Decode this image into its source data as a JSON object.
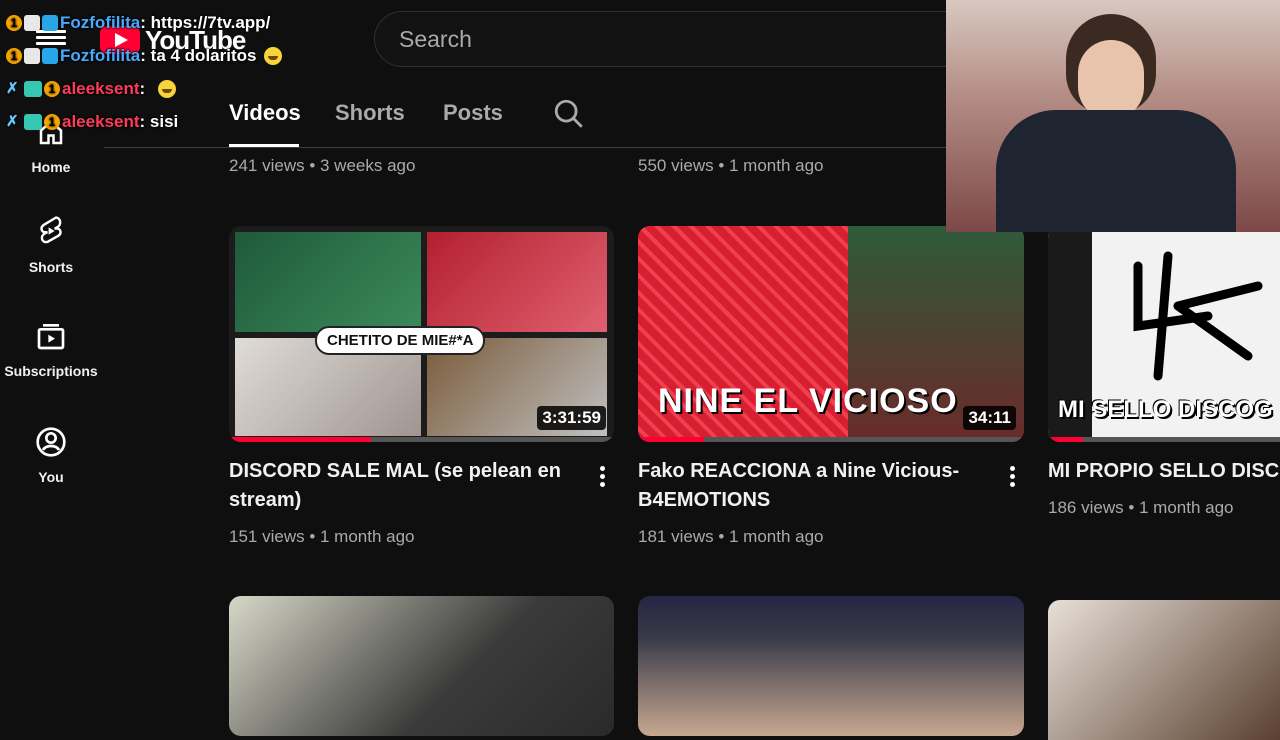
{
  "header": {
    "logo_text": "YouTube",
    "search_placeholder": "Search"
  },
  "sidebar": {
    "items": [
      {
        "label": "Home",
        "icon": "home-icon"
      },
      {
        "label": "Shorts",
        "icon": "shorts-icon"
      },
      {
        "label": "Subscriptions",
        "icon": "subscriptions-icon"
      },
      {
        "label": "You",
        "icon": "you-icon"
      }
    ]
  },
  "tabs": [
    {
      "label": "Videos",
      "active": true
    },
    {
      "label": "Shorts",
      "active": false
    },
    {
      "label": "Posts",
      "active": false
    }
  ],
  "top_row_meta": [
    "241 views • 3 weeks ago",
    "550 views • 1 month ago"
  ],
  "videos": [
    {
      "title": "DISCORD SALE MAL (se pelean en stream)",
      "meta": "151 views • 1 month ago",
      "duration": "3:31:59",
      "thumb_text": "CHETITO DE MIE#*A",
      "watched": 0.37
    },
    {
      "title": "Fako REACCIONA a Nine Vicious-B4EMOTIONS",
      "meta": "181 views • 1 month ago",
      "duration": "34:11",
      "thumb_text": "NINE EL VICIOSO",
      "watched": 0.17
    },
    {
      "title": "MI PROPIO SELLO DISCOG",
      "meta": "186 views • 1 month ago",
      "duration": "",
      "thumb_text": "MI SELLO DISCOG",
      "watched": 0.15
    }
  ],
  "chat": [
    {
      "user": "Fozfofilita",
      "message": "https://7tv.app/",
      "user_color": "#4aa8ff",
      "emote": false
    },
    {
      "user": "Fozfofilita",
      "message": "ta 4 dolaritos",
      "user_color": "#4aa8ff",
      "emote": true
    },
    {
      "user": "aleeksent",
      "message": "",
      "user_color": "#ff3b5c",
      "emote": true
    },
    {
      "user": "aleeksent",
      "message": "sisi",
      "user_color": "#ff3b5c",
      "emote": false
    }
  ],
  "colors": {
    "background": "#0f0f0f",
    "accent": "#ff0033",
    "muted_text": "#aaaaaa"
  }
}
